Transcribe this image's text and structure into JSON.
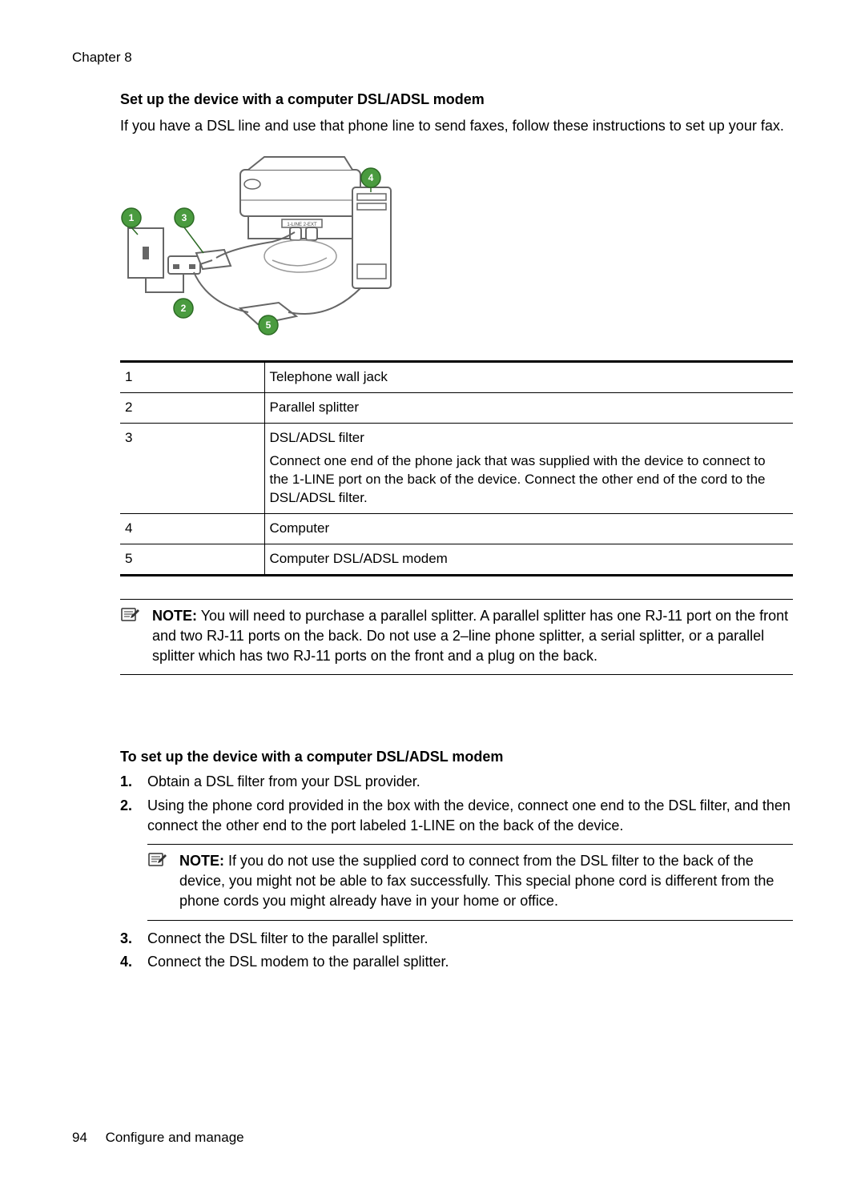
{
  "header": {
    "chapter": "Chapter 8"
  },
  "section": {
    "title": "Set up the device with a computer DSL/ADSL modem",
    "intro": "If you have a DSL line and use that phone line to send faxes, follow these instructions to set up your fax."
  },
  "legend": {
    "rows": [
      {
        "num": "1",
        "desc": "Telephone wall jack"
      },
      {
        "num": "2",
        "desc": "Parallel splitter"
      },
      {
        "num": "3",
        "desc": "DSL/ADSL filter",
        "sub": "Connect one end of the phone jack that was supplied with the device to connect to the 1-LINE port on the back of the device. Connect the other end of the cord to the DSL/ADSL filter."
      },
      {
        "num": "4",
        "desc": "Computer"
      },
      {
        "num": "5",
        "desc": "Computer DSL/ADSL modem"
      }
    ]
  },
  "note1": {
    "label": "NOTE:",
    "text": "You will need to purchase a parallel splitter. A parallel splitter has one RJ-11 port on the front and two RJ-11 ports on the back. Do not use a 2–line phone splitter, a serial splitter, or a parallel splitter which has two RJ-11 ports on the front and a plug on the back."
  },
  "subsection": {
    "title": "To set up the device with a computer DSL/ADSL modem"
  },
  "steps": {
    "s1": "Obtain a DSL filter from your DSL provider.",
    "s2": "Using the phone cord provided in the box with the device, connect one end to the DSL filter, and then connect the other end to the port labeled 1-LINE on the back of the device.",
    "s3": "Connect the DSL filter to the parallel splitter.",
    "s4": "Connect the DSL modem to the parallel splitter."
  },
  "note2": {
    "label": "NOTE:",
    "text": "If you do not use the supplied cord to connect from the DSL filter to the back of the device, you might not be able to fax successfully. This special phone cord is different from the phone cords you might already have in your home or office."
  },
  "footer": {
    "page": "94",
    "section_name": "Configure and manage"
  }
}
